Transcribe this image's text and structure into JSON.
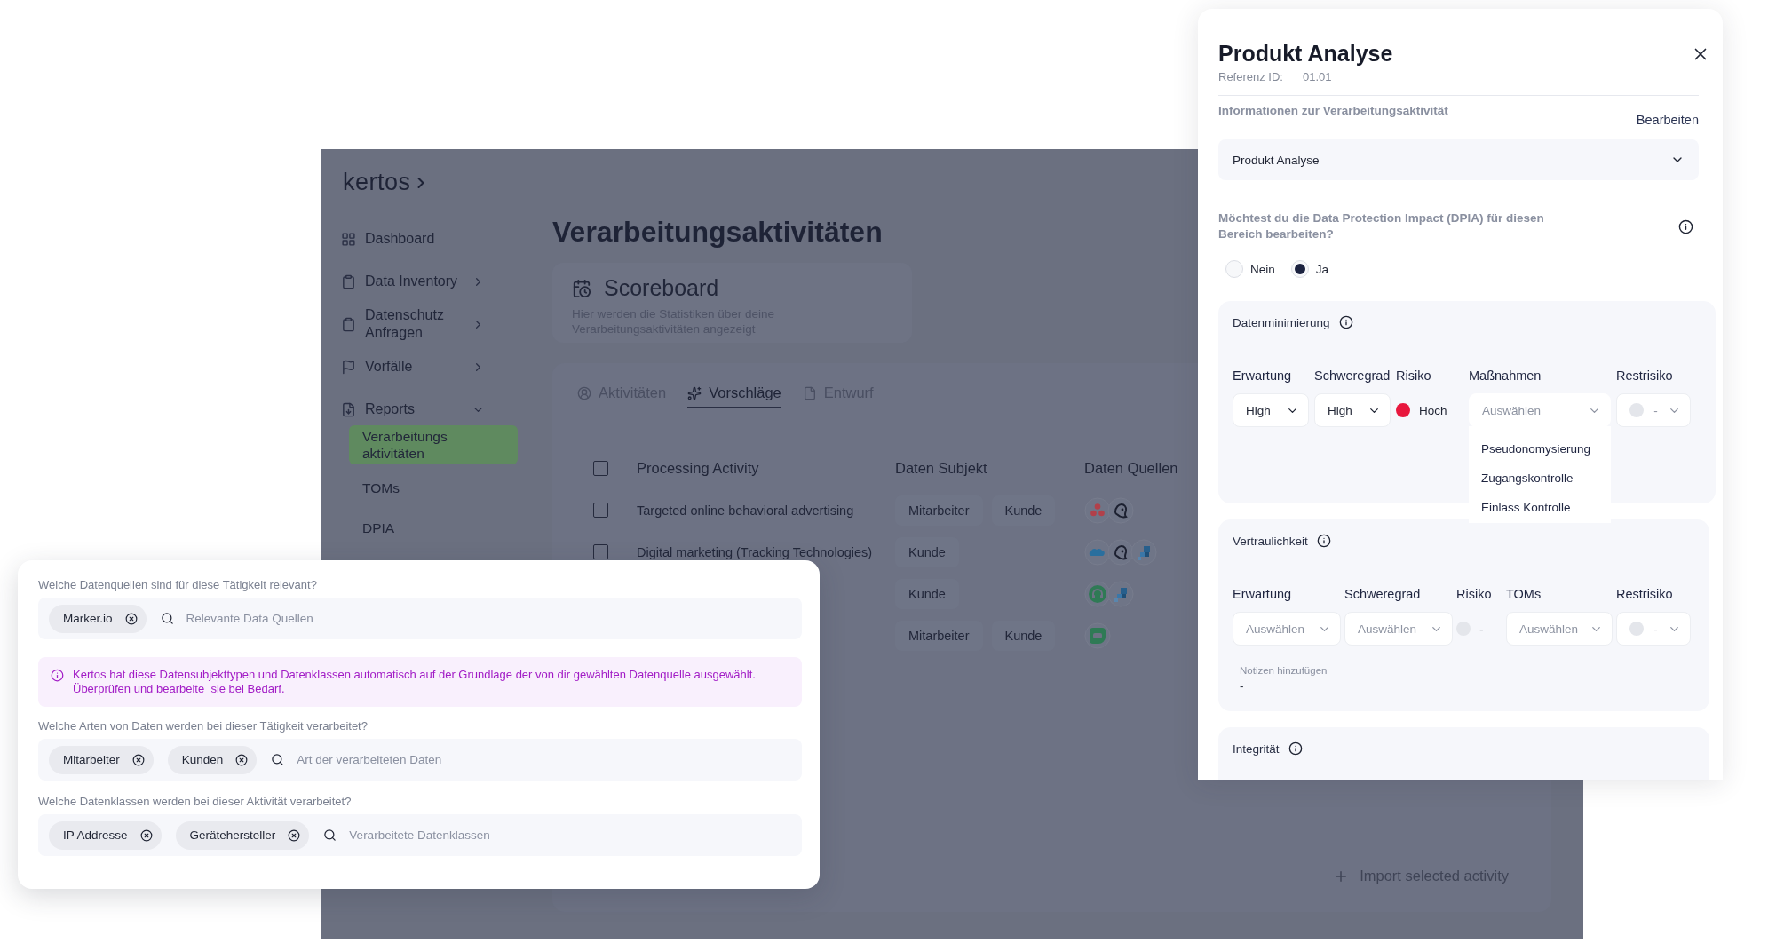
{
  "app": {
    "logo": "kertos",
    "sidebar": {
      "items": [
        {
          "label": "Dashboard",
          "kind": "link"
        },
        {
          "label": "Data Inventory",
          "kind": "group",
          "expanded": false
        },
        {
          "label": "Datenschutz Anfragen",
          "kind": "group",
          "expanded": false
        },
        {
          "label": "Vorfälle",
          "kind": "group",
          "expanded": false
        },
        {
          "label": "Reports",
          "kind": "group",
          "expanded": true,
          "children": [
            {
              "label": "Verarbeitungs aktivitäten",
              "selected": true
            },
            {
              "label": "TOMs",
              "selected": false
            },
            {
              "label": "DPIA",
              "selected": false
            }
          ]
        }
      ]
    },
    "page_title": "Verarbeitungsaktivitäten",
    "scoreboard": {
      "title": "Scoreboard",
      "description": "Hier werden die Statistiken über deine Verarbeitungsaktivitäten angezeigt"
    },
    "tabs": [
      {
        "label": "Aktivitäten",
        "selected": false
      },
      {
        "label": "Vorschläge",
        "selected": true
      },
      {
        "label": "Entwurf",
        "selected": false
      }
    ],
    "table": {
      "columns": [
        "Processing Activity",
        "Daten Subjekt",
        "Daten Quellen"
      ],
      "all_checked": false,
      "rows": [
        {
          "checked": false,
          "activity": "Targeted online behavioral advertising",
          "subjects": [
            "Mitarbeiter",
            "Kunde"
          ],
          "sources": [
            {
              "kind": "dots"
            },
            {
              "kind": "swirl"
            }
          ]
        },
        {
          "checked": false,
          "activity": "Digital marketing (Tracking Technologies)",
          "subjects": [
            "Kunde"
          ],
          "sources": [
            {
              "kind": "cloud"
            },
            {
              "kind": "swirl"
            },
            {
              "kind": "squares"
            }
          ]
        },
        {
          "subjects": [
            "Kunde"
          ],
          "sources": [
            {
              "kind": "headset"
            },
            {
              "kind": "squares"
            }
          ]
        },
        {
          "subjects": [
            "Mitarbeiter",
            "Kunde"
          ],
          "sources": [
            {
              "kind": "chat"
            }
          ]
        }
      ]
    },
    "import_button": "Import selected activity"
  },
  "detail_panel": {
    "title": "Produkt Analyse",
    "reference_label": "Referenz ID:",
    "reference_value": "01.01",
    "info_label": "Informationen zur Verarbeitungsaktivität",
    "edit_button": "Bearbeiten",
    "activity_select": "Produkt Analyse",
    "question": "Möchtest du die Data Protection Impact (DPIA) für diesen Bereich bearbeiten?",
    "options": [
      {
        "label": "Nein",
        "selected": false
      },
      {
        "label": "Ja",
        "selected": true
      }
    ],
    "sections": [
      {
        "title": "Datenminimierung",
        "columns": [
          "Erwartung",
          "Schweregrad",
          "Risiko",
          "Maßnahmen",
          "Restrisiko"
        ],
        "cells": [
          {
            "kind": "select",
            "value": "High"
          },
          {
            "kind": "select",
            "value": "High"
          },
          {
            "kind": "risk",
            "color": "#e8173d",
            "value": "Hoch"
          },
          {
            "kind": "select",
            "placeholder": "Auswählen",
            "expanded": true,
            "options": [
              "Pseudonomysierung",
              "Zugangskontrolle",
              "Einlass Kontrolle"
            ]
          },
          {
            "kind": "risk-select",
            "color": "#e4e6eb",
            "placeholder": "-"
          }
        ]
      },
      {
        "title": "Vertraulichkeit",
        "columns": [
          "Erwartung",
          "Schweregrad",
          "Risiko",
          "TOMs",
          "Restrisiko"
        ],
        "cells": [
          {
            "kind": "select",
            "placeholder": "Auswählen",
            "expanded": false
          },
          {
            "kind": "select",
            "placeholder": "Auswählen",
            "expanded": false
          },
          {
            "kind": "risk",
            "color": "#e4e6eb",
            "value": "-"
          },
          {
            "kind": "select",
            "placeholder": "Auswählen",
            "expanded": false
          },
          {
            "kind": "risk-select",
            "color": "#e4e6eb",
            "placeholder": "-"
          }
        ],
        "notes_label": "Notizen hinzufügen",
        "notes_value": "-"
      },
      {
        "title": "Integrität"
      }
    ]
  },
  "sources_card": {
    "items": [
      {
        "kind": "field",
        "question": "Welche Datenquellen sind für diese Tätigkeit relevant?",
        "tags": [
          "Marker.io"
        ],
        "placeholder": "Relevante Data Quellen"
      },
      {
        "kind": "notice",
        "text": "Kertos hat diese Datensubjekttypen und Datenklassen automatisch auf der Grundlage der von dir gewählten Datenquelle ausgewählt. Überprüfen und bearbeite  sie bei Bedarf."
      },
      {
        "kind": "field",
        "question": "Welche Arten von Daten werden bei dieser Tätigkeit verarbeitet?",
        "tags": [
          "Mitarbeiter",
          "Kunden"
        ],
        "placeholder": "Art der verarbeiteten Daten"
      },
      {
        "kind": "field",
        "question": "Welche Datenklassen werden bei dieser Aktivität verarbeitet?",
        "tags": [
          "IP Addresse",
          "Gerätehersteller"
        ],
        "placeholder": "Verarbeitete Datenklassen"
      }
    ]
  }
}
